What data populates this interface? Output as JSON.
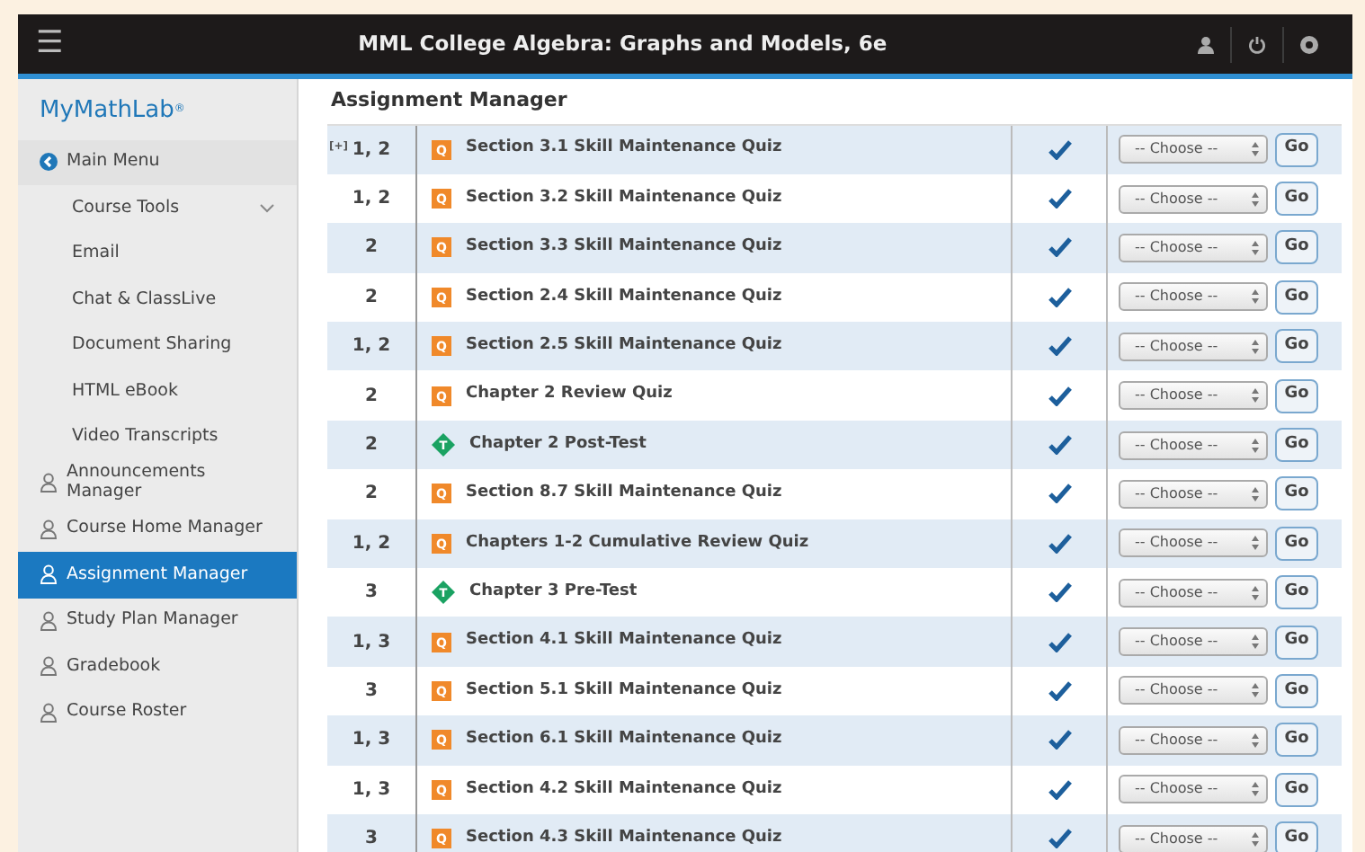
{
  "header": {
    "menu_glyph": "☰",
    "title": "MML College Algebra: Graphs and Models, 6e"
  },
  "sidebar": {
    "brand": "MyMathLab",
    "brand_mark": "®",
    "items": [
      {
        "label": "Main Menu",
        "kind": "back",
        "selected": false
      },
      {
        "label": "Course Tools",
        "kind": "group",
        "expanded": true,
        "selected": false
      },
      {
        "label": "Email",
        "kind": "sub",
        "selected": false
      },
      {
        "label": "Chat & ClassLive",
        "kind": "sub",
        "selected": false
      },
      {
        "label": "Document Sharing",
        "kind": "sub",
        "selected": false
      },
      {
        "label": "HTML eBook",
        "kind": "sub",
        "selected": false
      },
      {
        "label": "Video Transcripts",
        "kind": "sub",
        "selected": false
      },
      {
        "label": "Announcements Manager",
        "kind": "person",
        "selected": false
      },
      {
        "label": "Course Home Manager",
        "kind": "person",
        "selected": false
      },
      {
        "label": "Assignment Manager",
        "kind": "person",
        "selected": true
      },
      {
        "label": "Study Plan Manager",
        "kind": "person",
        "selected": false
      },
      {
        "label": "Gradebook",
        "kind": "person",
        "selected": false
      },
      {
        "label": "Course Roster",
        "kind": "person",
        "selected": false
      }
    ]
  },
  "content": {
    "heading": "Assignment Manager",
    "expander": "[+]",
    "rows": [
      {
        "chapters": "1, 2",
        "kind": "quiz",
        "badge": "Q",
        "title": "Section 3.1 Skill Maintenance Quiz",
        "checked": true,
        "placeholder": "-- Choose --",
        "action": "Go"
      },
      {
        "chapters": "1, 2",
        "kind": "quiz",
        "badge": "Q",
        "title": "Section 3.2 Skill Maintenance Quiz",
        "checked": true,
        "placeholder": "-- Choose --",
        "action": "Go"
      },
      {
        "chapters": "2",
        "kind": "quiz",
        "badge": "Q",
        "title": "Section 3.3 Skill Maintenance Quiz",
        "checked": true,
        "placeholder": "-- Choose --",
        "action": "Go"
      },
      {
        "chapters": "2",
        "kind": "quiz",
        "badge": "Q",
        "title": "Section 2.4 Skill Maintenance Quiz",
        "checked": true,
        "placeholder": "-- Choose --",
        "action": "Go"
      },
      {
        "chapters": "1, 2",
        "kind": "quiz",
        "badge": "Q",
        "title": "Section 2.5 Skill Maintenance Quiz",
        "checked": true,
        "placeholder": "-- Choose --",
        "action": "Go"
      },
      {
        "chapters": "2",
        "kind": "quiz",
        "badge": "Q",
        "title": "Chapter 2 Review Quiz",
        "checked": true,
        "placeholder": "-- Choose --",
        "action": "Go"
      },
      {
        "chapters": "2",
        "kind": "test",
        "badge": "T",
        "title": "Chapter 2 Post-Test",
        "checked": true,
        "placeholder": "-- Choose --",
        "action": "Go"
      },
      {
        "chapters": "2",
        "kind": "quiz",
        "badge": "Q",
        "title": "Section 8.7 Skill Maintenance Quiz",
        "checked": true,
        "placeholder": "-- Choose --",
        "action": "Go"
      },
      {
        "chapters": "1, 2",
        "kind": "quiz",
        "badge": "Q",
        "title": "Chapters 1-2 Cumulative Review Quiz",
        "checked": true,
        "placeholder": "-- Choose --",
        "action": "Go"
      },
      {
        "chapters": "3",
        "kind": "test",
        "badge": "T",
        "title": "Chapter 3 Pre-Test",
        "checked": true,
        "placeholder": "-- Choose --",
        "action": "Go"
      },
      {
        "chapters": "1, 3",
        "kind": "quiz",
        "badge": "Q",
        "title": "Section 4.1 Skill Maintenance Quiz",
        "checked": true,
        "placeholder": "-- Choose --",
        "action": "Go"
      },
      {
        "chapters": "3",
        "kind": "quiz",
        "badge": "Q",
        "title": "Section 5.1 Skill Maintenance Quiz",
        "checked": true,
        "placeholder": "-- Choose --",
        "action": "Go"
      },
      {
        "chapters": "1, 3",
        "kind": "quiz",
        "badge": "Q",
        "title": "Section 6.1 Skill Maintenance Quiz",
        "checked": true,
        "placeholder": "-- Choose --",
        "action": "Go"
      },
      {
        "chapters": "1, 3",
        "kind": "quiz",
        "badge": "Q",
        "title": "Section 4.2 Skill Maintenance Quiz",
        "checked": true,
        "placeholder": "-- Choose --",
        "action": "Go"
      },
      {
        "chapters": "3",
        "kind": "quiz",
        "badge": "Q",
        "title": "Section 4.3 Skill Maintenance Quiz",
        "checked": true,
        "placeholder": "-- Choose --",
        "action": "Go"
      }
    ]
  }
}
